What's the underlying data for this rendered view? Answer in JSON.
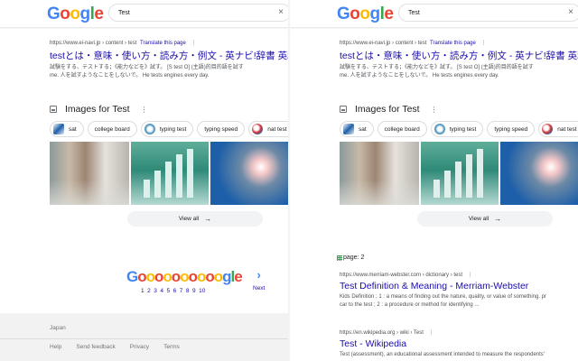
{
  "search": {
    "query": "Test",
    "clear_symbol": "×"
  },
  "logo_letters": [
    {
      "ch": "G",
      "color": "#4285f4"
    },
    {
      "ch": "o",
      "color": "#ea4335"
    },
    {
      "ch": "o",
      "color": "#fbbc05"
    },
    {
      "ch": "g",
      "color": "#4285f4"
    },
    {
      "ch": "l",
      "color": "#34a853"
    },
    {
      "ch": "e",
      "color": "#ea4335"
    }
  ],
  "result_einavi": {
    "cite": "https://www.ei-navi.jp › content › test",
    "translate": "Translate this page",
    "title": "testとは・意味・使い方・読み方・例文 - 英ナビ!辞書 英和辞",
    "snippet_line1": "試験をする、テストする；《能力などを》試す。 [S test O] (主語)的目的語を試す",
    "snippet_line2": "me. 人を試すようなことをしないで。 He tests engines every day."
  },
  "images_section": {
    "title": "Images for Test",
    "chips": [
      {
        "label": "sat",
        "thumb": "sat"
      },
      {
        "label": "college board",
        "thumb": ""
      },
      {
        "label": "typing test",
        "thumb": "typing"
      },
      {
        "label": "typing speed",
        "thumb": ""
      },
      {
        "label": "nat test",
        "thumb": "nat"
      }
    ],
    "view_all": "View all",
    "view_all_arrow": "→"
  },
  "pagination": {
    "pages": [
      "1",
      "2",
      "3",
      "4",
      "5",
      "6",
      "7",
      "8",
      "9",
      "10"
    ],
    "current": "1",
    "next_label": "Next",
    "next_chevron": "›"
  },
  "footer": {
    "location": "Japan",
    "links": [
      "Help",
      "Send feedback",
      "Privacy",
      "Terms"
    ]
  },
  "page_marker": {
    "label": "page: 2"
  },
  "result_mw": {
    "cite": "https://www.merriam-webster.com › dictionary › test",
    "title": "Test Definition & Meaning - Merriam-Webster",
    "snippet_line1": "Kids Definition ; 1 : a means of finding out the nature, quality, or value of something. pr",
    "snippet_line2": "car to the test ; 2 : a procedure or method for identifying ..."
  },
  "result_wiki": {
    "cite": "https://en.wikipedia.org › wiki › Test",
    "title": "Test - Wikipedia",
    "snippet_line1": "Test (assessment), an educational assessment intended to measure the respondents'"
  },
  "menu_dots": "⋮"
}
